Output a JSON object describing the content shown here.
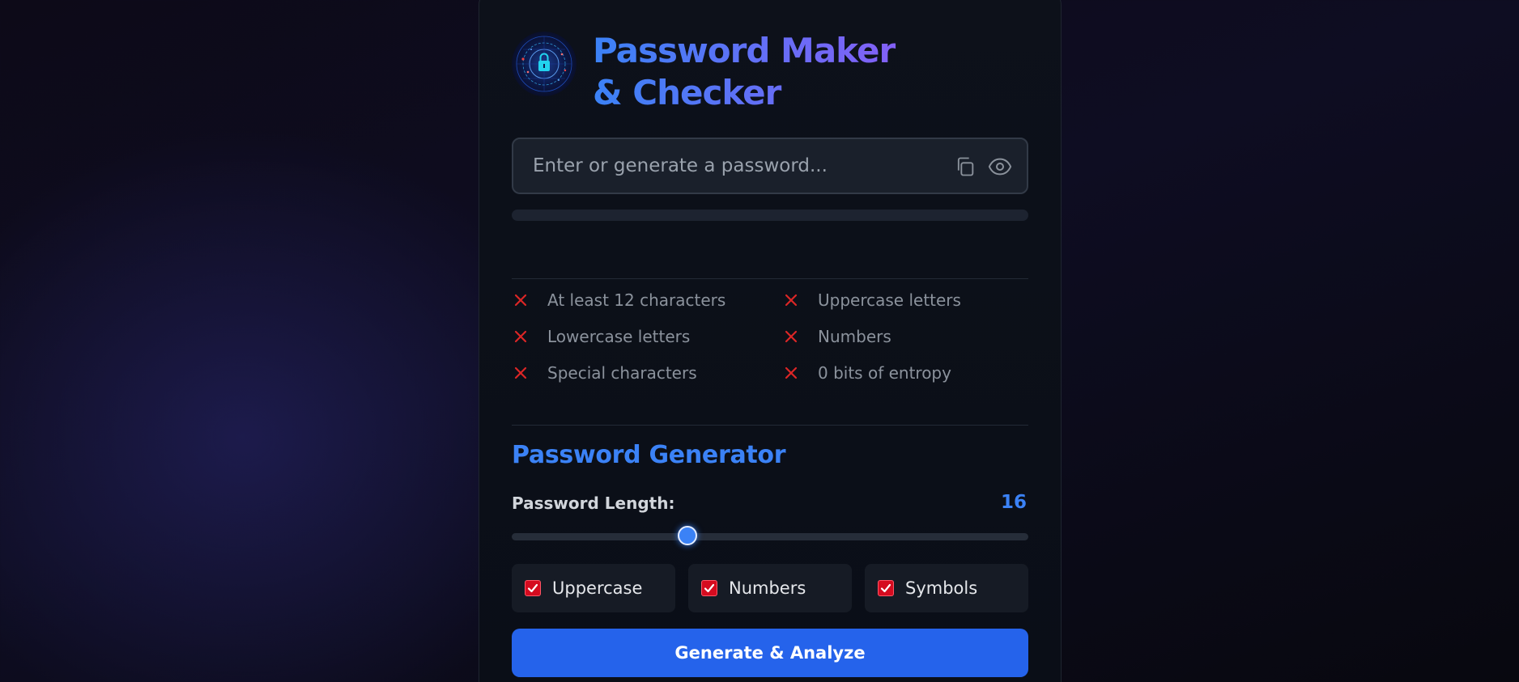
{
  "app": {
    "title": "Password Maker & Checker"
  },
  "password_input": {
    "placeholder": "Enter or generate a password...",
    "value": ""
  },
  "strength": {
    "level": 0
  },
  "checks": [
    {
      "label": "At least 12 characters",
      "passed": false
    },
    {
      "label": "Uppercase letters",
      "passed": false
    },
    {
      "label": "Lowercase letters",
      "passed": false
    },
    {
      "label": "Numbers",
      "passed": false
    },
    {
      "label": "Special characters",
      "passed": false
    },
    {
      "label": "0 bits of entropy",
      "passed": false
    }
  ],
  "generator": {
    "section_title": "Password Generator",
    "length_label": "Password Length:",
    "length_value": "16",
    "length_fraction": 0.34,
    "options": [
      {
        "label": "Uppercase",
        "checked": true
      },
      {
        "label": "Numbers",
        "checked": true
      },
      {
        "label": "Symbols",
        "checked": true
      }
    ],
    "button_label": "Generate & Analyze"
  },
  "icons": {
    "copy": "copy-icon",
    "show": "eye-icon",
    "fail": "x-icon",
    "logo": "lock-globe-logo"
  },
  "colors": {
    "accent": "#3b82f6",
    "accent_end": "#8b5cf6",
    "fail": "#dc2626",
    "button": "#2563eb"
  }
}
